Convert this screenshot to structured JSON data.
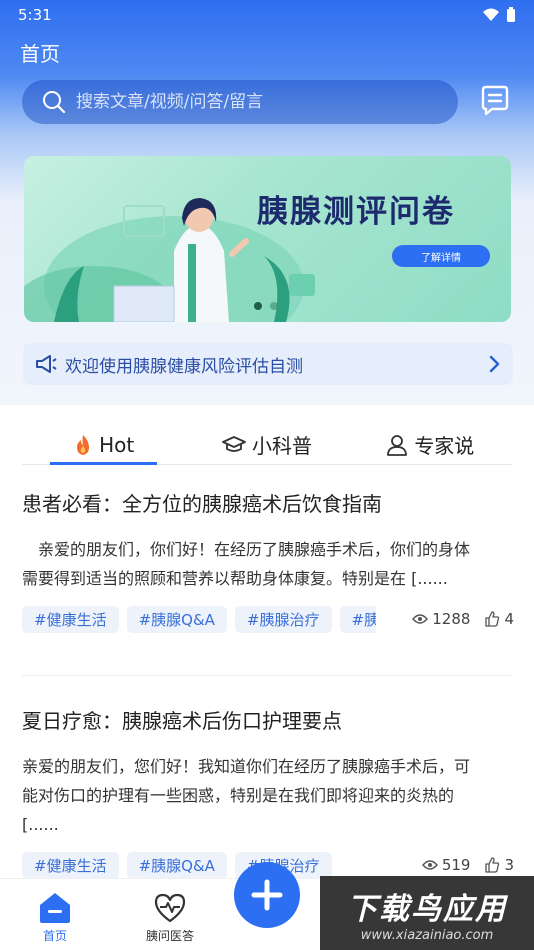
{
  "status_bar": {
    "time": "5:31"
  },
  "header": {
    "title": "首页"
  },
  "search": {
    "placeholder": "搜索文章/视频/问答/留言"
  },
  "banner": {
    "title": "胰腺测评问卷",
    "button_label": "了解详情"
  },
  "notice": {
    "text": "欢迎使用胰腺健康风险评估自测"
  },
  "tabs": [
    {
      "label": "Hot"
    },
    {
      "label": "小科普"
    },
    {
      "label": "专家说"
    }
  ],
  "articles": [
    {
      "title": "患者必看：全方位的胰腺癌术后饮食指南",
      "excerpt": "　亲爱的朋友们，你们好！在经历了胰腺癌手术后，你们的身体需要得到适当的照顾和营养以帮助身体康复。特别是在 [......",
      "tags": [
        "#健康生活",
        "#胰腺Q&A",
        "#胰腺治疗",
        "#胰腺"
      ],
      "views": "1288",
      "likes": "4"
    },
    {
      "title": "夏日疗愈：胰腺癌术后伤口护理要点",
      "excerpt": "亲爱的朋友们，您们好！我知道你们在经历了胰腺癌手术后，可能对伤口的护理有一些困惑，特别是在我们即将迎来的炎热的 [......",
      "tags": [
        "#健康生活",
        "#胰腺Q&A",
        "#胰腺治疗"
      ],
      "views": "519",
      "likes": "3"
    }
  ],
  "bottom_nav": {
    "home": "首页",
    "consult": "胰问医答"
  },
  "watermark": {
    "big": "下载鸟应用",
    "small": "www.xiazainiao.com"
  },
  "colors": {
    "primary": "#2d6ff2",
    "tag_text": "#3a6fd8",
    "tag_bg": "#eef3fb"
  }
}
